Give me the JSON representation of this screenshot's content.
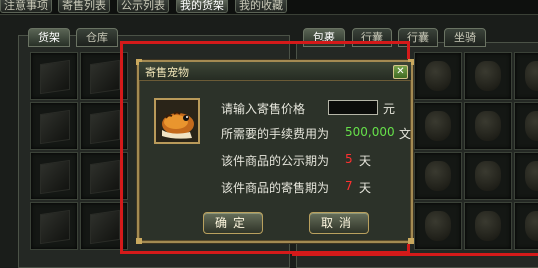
{
  "top_tabs": [
    {
      "label": "注意事项",
      "active": false
    },
    {
      "label": "寄售列表",
      "active": false
    },
    {
      "label": "公示列表",
      "active": false
    },
    {
      "label": "我的货架",
      "active": true
    },
    {
      "label": "我的收藏",
      "active": false
    }
  ],
  "left_panel": {
    "tabs": [
      {
        "label": "货架",
        "active": true
      },
      {
        "label": "仓库",
        "active": false
      }
    ]
  },
  "right_panel": {
    "tabs": [
      {
        "label": "包裹",
        "active": true
      },
      {
        "label": "行囊",
        "active": false
      },
      {
        "label": "行囊",
        "active": false
      },
      {
        "label": "坐骑",
        "active": false
      }
    ]
  },
  "dialog": {
    "title": "寄售宠物",
    "close_label": "✕",
    "price_prompt": "请输入寄售价格",
    "price_value": "",
    "price_unit": "元",
    "fee_label": "所需要的手续费用为",
    "fee_value": "500,000",
    "fee_unit": "文",
    "publicity_label": "该件商品的公示期为",
    "publicity_days": "5",
    "publicity_unit": "天",
    "sale_label": "该件商品的寄售期为",
    "sale_days": "7",
    "sale_unit": "天",
    "confirm_label": "确定",
    "cancel_label": "取消"
  },
  "colors": {
    "highlight_red": "#d41a1a",
    "fee_green": "#66e04a",
    "days_red": "#ff3030",
    "frame_gold": "#a48a52"
  },
  "icons": [
    "pet-portrait-icon",
    "close-icon",
    "item-box-icon",
    "item-bag-icon"
  ]
}
